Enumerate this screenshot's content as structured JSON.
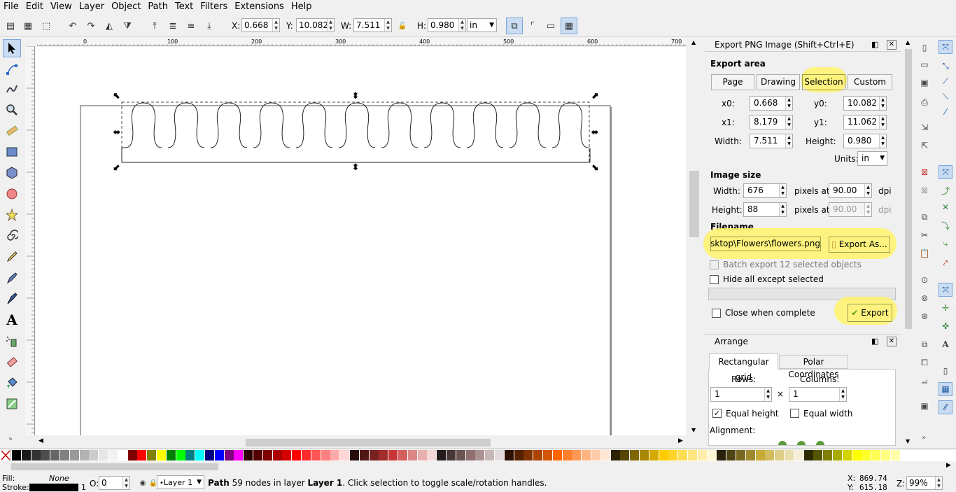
{
  "menu": [
    "File",
    "Edit",
    "View",
    "Layer",
    "Object",
    "Path",
    "Text",
    "Filters",
    "Extensions",
    "Help"
  ],
  "toolbar": {
    "x_label": "X:",
    "x_value": "0.668",
    "y_label": "Y:",
    "y_value": "10.082",
    "w_label": "W:",
    "w_value": "7.511",
    "h_label": "H:",
    "h_value": "0.980",
    "unit": "in"
  },
  "ruler": {
    "h_ticks": [
      "0",
      "100",
      "200",
      "300",
      "400",
      "500",
      "600",
      "700"
    ]
  },
  "export": {
    "title": "Export PNG Image (Shift+Ctrl+E)",
    "area_label": "Export area",
    "area_buttons": [
      "Page",
      "Drawing",
      "Selection",
      "Custom"
    ],
    "x0_label": "x0:",
    "x0": "0.668",
    "y0_label": "y0:",
    "y0": "10.082",
    "x1_label": "x1:",
    "x1": "8.179",
    "y1_label": "y1:",
    "y1": "11.062",
    "width_label": "Width:",
    "width": "7.511",
    "height_label": "Height:",
    "height": "0.980",
    "units_label": "Units:",
    "units": "in",
    "image_size_label": "Image size",
    "img_width_label": "Width:",
    "img_width": "676",
    "img_height_label": "Height:",
    "img_height": "88",
    "pixels_at": "pixels at",
    "dpi_x": "90.00",
    "dpi_y": "90.00",
    "dpi": "dpi",
    "filename_label": "Filename",
    "filename": "Desktop\\Flowers\\flowers.png",
    "export_as": "Export As...",
    "batch": "Batch export 12 selected objects",
    "hide_all": "Hide all except selected",
    "close_when": "Close when complete",
    "export_btn": "Export"
  },
  "arrange": {
    "title": "Arrange",
    "tab_rect": "Rectangular grid",
    "tab_polar": "Polar Coordinates",
    "rows_label": "Rows:",
    "rows": "1",
    "cols_label": "Columns:",
    "cols": "1",
    "times": "×",
    "equal_height": "Equal height",
    "equal_width": "Equal width",
    "alignment": "Alignment:"
  },
  "status": {
    "fill_label": "Fill:",
    "fill_value": "None",
    "stroke_label": "Stroke:",
    "stroke_width": "1",
    "opacity_label": "O:",
    "opacity": "0",
    "layer": "Layer 1",
    "msg_bold1": "Path",
    "msg_mid": " 59 nodes in layer ",
    "msg_bold2": "Layer 1",
    "msg_end": ". Click selection to toggle scale/rotation handles.",
    "cx_label": "X:",
    "cx": "869.74",
    "cy_label": "Y:",
    "cy": "615.18",
    "zoom_label": "Z:",
    "zoom": "99%"
  },
  "colors": {
    "highlight": "#fff36a",
    "accent": "#c9dcf2"
  }
}
